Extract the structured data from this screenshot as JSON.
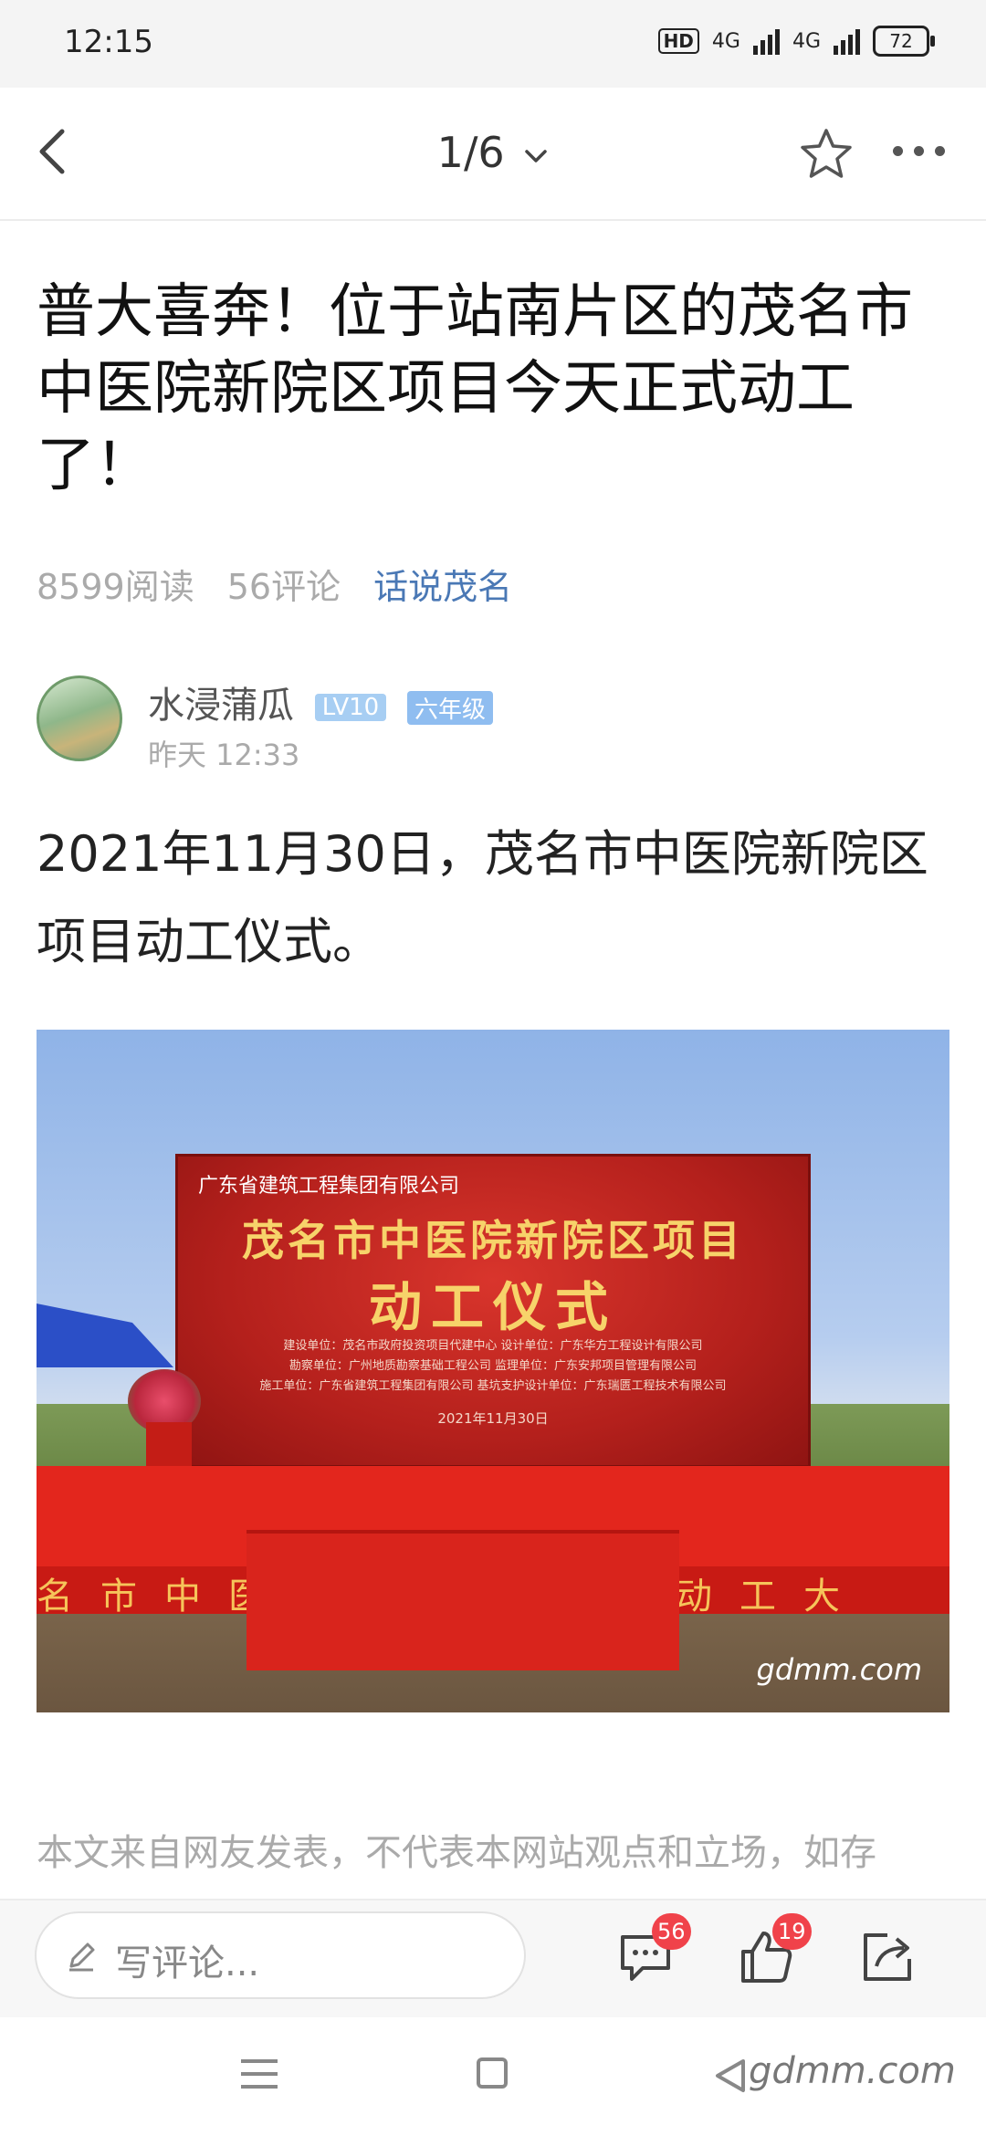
{
  "status": {
    "time": "12:15",
    "hd": "HD",
    "net1": "4G",
    "net2": "4G",
    "battery": "72"
  },
  "nav": {
    "pager": "1/6"
  },
  "article": {
    "title": "普大喜奔！位于站南片区的茂名市中医院新院区项目今天正式动工了！",
    "reads": "8599阅读",
    "comments": "56评论",
    "topic": "话说茂名",
    "author": "水浸蒲瓜",
    "level": "LV10",
    "grade": "六年级",
    "time": "昨天 12:33",
    "body": "2021年11月30日，茂名市中医院新院区项目动工仪式。",
    "disclaimer": "本文来自网友发表，不代表本网站观点和立场，如存"
  },
  "photo": {
    "company": "广东省建筑工程集团有限公司",
    "headline": "茂名市中医院新院区项目",
    "subheadline": "动工仪式",
    "line1": "建设单位：茂名市政府投资项目代建中心    设计单位：广东华方工程设计有限公司",
    "line2": "勘察单位：广州地质勘察基础工程公司    监理单位：广东安邦项目管理有限公司",
    "line3": "施工单位：广东省建筑工程集团有限公司    基坑支护设计单位：广东瑞匮工程技术有限公司",
    "date": "2021年11月30日",
    "stage_text": "名市中医院新院区项目动工大",
    "watermark": "gdmm.com"
  },
  "comment_bar": {
    "placeholder": "写评论...",
    "comment_count": "56",
    "like_count": "19"
  },
  "sysnav": {
    "watermark": "gdmm.com"
  }
}
